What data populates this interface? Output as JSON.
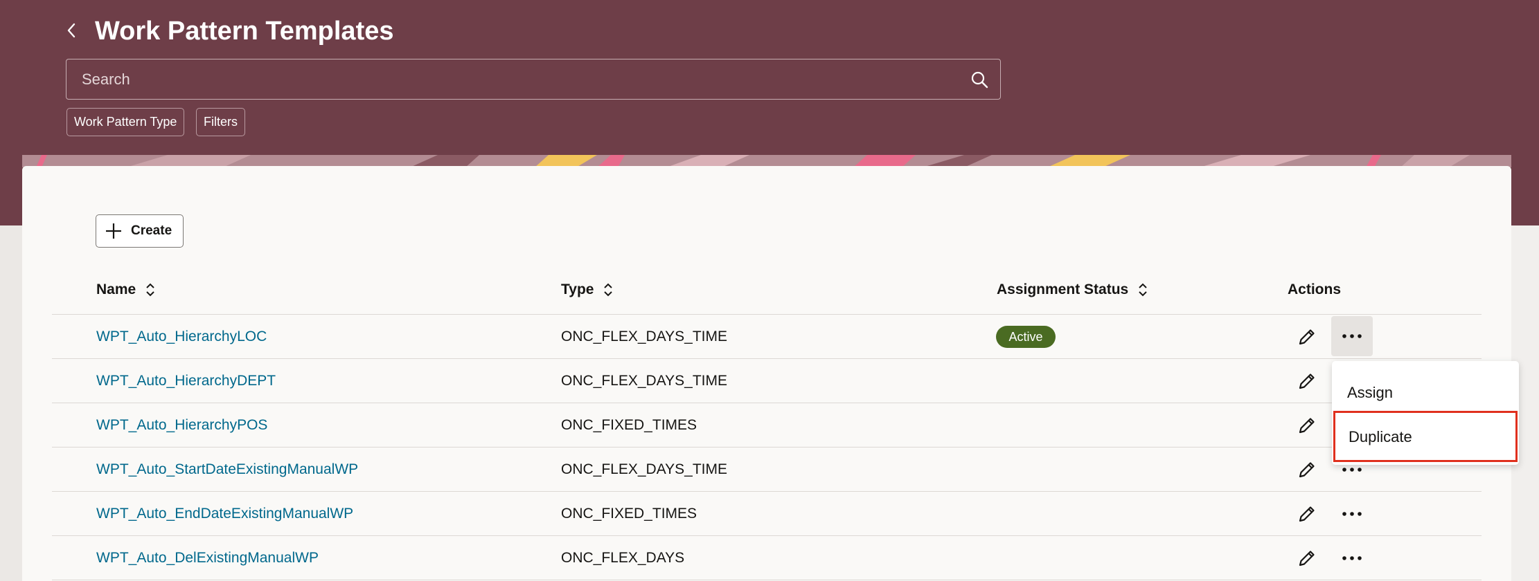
{
  "header": {
    "title": "Work Pattern Templates",
    "back_icon": "chevron-left-icon"
  },
  "search": {
    "placeholder": "Search",
    "value": "",
    "icon": "search-icon"
  },
  "filters": {
    "chips": [
      "Work Pattern Type",
      "Filters"
    ]
  },
  "toolbar": {
    "create_label": "Create"
  },
  "table": {
    "columns": {
      "name": "Name",
      "type": "Type",
      "assignment_status": "Assignment Status",
      "actions": "Actions"
    },
    "rows": [
      {
        "name": "WPT_Auto_HierarchyLOC",
        "type": "ONC_FLEX_DAYS_TIME",
        "status": "Active"
      },
      {
        "name": "WPT_Auto_HierarchyDEPT",
        "type": "ONC_FLEX_DAYS_TIME",
        "status": ""
      },
      {
        "name": "WPT_Auto_HierarchyPOS",
        "type": "ONC_FIXED_TIMES",
        "status": ""
      },
      {
        "name": "WPT_Auto_StartDateExistingManualWP",
        "type": "ONC_FLEX_DAYS_TIME",
        "status": ""
      },
      {
        "name": "WPT_Auto_EndDateExistingManualWP",
        "type": "ONC_FIXED_TIMES",
        "status": ""
      },
      {
        "name": "WPT_Auto_DelExistingManualWP",
        "type": "ONC_FLEX_DAYS",
        "status": ""
      }
    ]
  },
  "actions_menu": {
    "items": [
      "Assign",
      "Duplicate"
    ],
    "highlighted": "Duplicate"
  },
  "colors": {
    "header_bg": "#6e3e48",
    "link": "#00688c",
    "active_badge": "#4a6b22",
    "highlight_border": "#e0301e"
  }
}
